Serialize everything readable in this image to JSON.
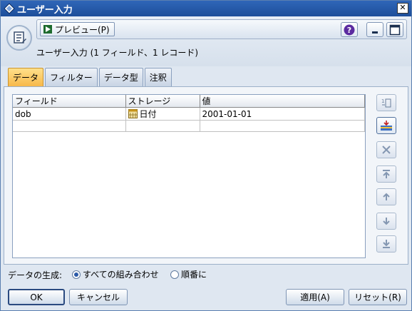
{
  "window": {
    "title": "ユーザー入力",
    "close_symbol": "✕",
    "icon": "diamond-app-icon"
  },
  "toolbar": {
    "preview_label": "プレビュー(P)",
    "help_symbol": "?",
    "node_title": "ユーザー入力 (1 フィールド、1 レコード)"
  },
  "tabs": [
    {
      "label": "データ",
      "active": true
    },
    {
      "label": "フィルター",
      "active": false
    },
    {
      "label": "データ型",
      "active": false
    },
    {
      "label": "注釈",
      "active": false
    }
  ],
  "table": {
    "headers": [
      "フィールド",
      "ストレージ",
      "値"
    ],
    "rows": [
      {
        "field": "dob",
        "storage": "日付",
        "value": "2001-01-01"
      }
    ]
  },
  "side_buttons": [
    {
      "name": "import-fields-button",
      "icon": "import-icon"
    },
    {
      "name": "add-field-button",
      "icon": "add-row-icon"
    },
    {
      "name": "delete-field-button",
      "icon": "delete-icon"
    },
    {
      "name": "move-top-button",
      "icon": "move-top-icon"
    },
    {
      "name": "move-up-button",
      "icon": "move-up-icon"
    },
    {
      "name": "move-down-button",
      "icon": "move-down-icon"
    },
    {
      "name": "move-bottom-button",
      "icon": "move-bottom-icon"
    }
  ],
  "generation": {
    "label": "データの生成:",
    "options": [
      {
        "label": "すべての組み合わせ",
        "checked": true
      },
      {
        "label": "順番に",
        "checked": false
      }
    ]
  },
  "buttons": {
    "ok": "OK",
    "cancel": "キャンセル",
    "apply": "適用(A)",
    "reset": "リセット(R)"
  },
  "colors": {
    "titlebar": "#1d4e9a",
    "active_tab": "#f7b84a",
    "window_bg": "#dfe7f1"
  }
}
